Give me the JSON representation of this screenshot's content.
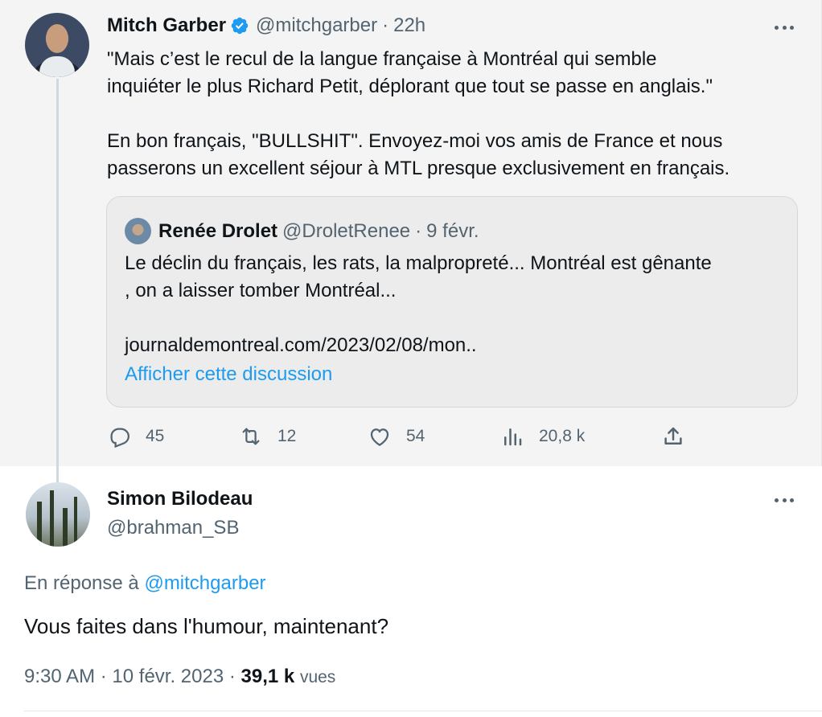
{
  "parent": {
    "display_name": "Mitch Garber",
    "handle": "@mitchgarber",
    "separator": "·",
    "time": "22h",
    "text": "\"Mais c’est le recul de la langue française à Montréal qui semble\ninquiéter le plus Richard Petit, déplorant que tout se passe en anglais.\"\n\nEn bon français, \"BULLSHIT\". Envoyez-moi vos amis de France et nous\npasserons un excellent séjour à MTL presque exclusivement en français.",
    "quote": {
      "display_name": "Renée Drolet",
      "handle": "@DroletRenee",
      "separator": "·",
      "date": "9 févr.",
      "text": "Le déclin du français, les rats, la malpropreté... Montréal est gênante\n, on a laisser tomber Montréal...\n\njournaldemontreal.com/2023/02/08/mon..",
      "show_thread": "Afficher cette discussion"
    },
    "actions": {
      "replies": "45",
      "retweets": "12",
      "likes": "54",
      "views": "20,8 k"
    }
  },
  "reply": {
    "display_name": "Simon Bilodeau",
    "handle": "@brahman_SB",
    "in_reply_prefix": "En réponse à",
    "in_reply_mention": "@mitchgarber",
    "text": "Vous faites dans l'humour, maintenant?",
    "time": "9:30 AM",
    "separator": "·",
    "date": "10 févr. 2023",
    "separator2": "·",
    "views_count": "39,1 k",
    "views_label": "vues"
  },
  "colors": {
    "accent": "#1d9bf0",
    "muted": "#536471",
    "text": "#0f1419"
  },
  "icons": [
    "verified-badge-icon",
    "more-icon",
    "reply-icon",
    "retweet-icon",
    "like-icon",
    "views-icon",
    "share-icon"
  ]
}
